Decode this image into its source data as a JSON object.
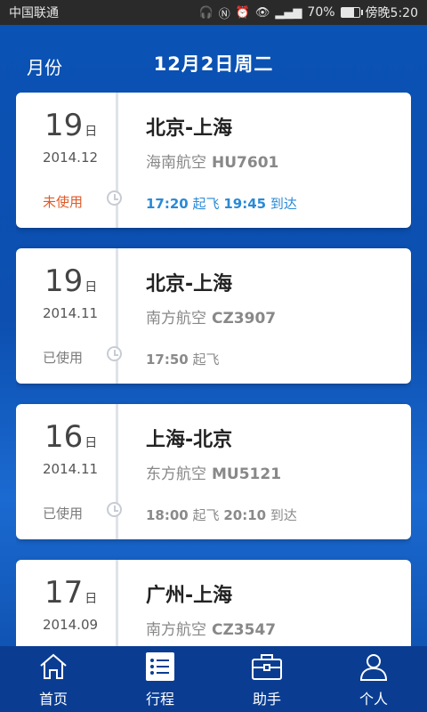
{
  "status_bar": {
    "carrier": "中国联通",
    "battery_text": "70%",
    "time": "傍晚5:20",
    "battery_level": 0.7,
    "icons": [
      "headset-icon",
      "nfc-icon",
      "alarm-icon",
      "eye-icon",
      "signal-icon",
      "battery-icon"
    ]
  },
  "header": {
    "month_label": "月份",
    "date_title": "12月2日周二"
  },
  "trips": [
    {
      "day": "19",
      "day_unit": "日",
      "year_month": "2014.12",
      "status": "未使用",
      "route": "北京-上海",
      "airline": "海南航空",
      "flight": "HU7601",
      "dep_time": "17:20",
      "dep_label": "起飞",
      "arr_time": "19:45",
      "arr_label": "到达"
    },
    {
      "day": "19",
      "day_unit": "日",
      "year_month": "2014.11",
      "status": "已使用",
      "route": "北京-上海",
      "airline": "南方航空",
      "flight": "CZ3907",
      "dep_time": "17:50",
      "dep_label": "起飞",
      "arr_time": "",
      "arr_label": ""
    },
    {
      "day": "16",
      "day_unit": "日",
      "year_month": "2014.11",
      "status": "已使用",
      "route": "上海-北京",
      "airline": "东方航空",
      "flight": "MU5121",
      "dep_time": "18:00",
      "dep_label": "起飞",
      "arr_time": "20:10",
      "arr_label": "到达"
    },
    {
      "day": "17",
      "day_unit": "日",
      "year_month": "2014.09",
      "status": "",
      "route": "广州-上海",
      "airline": "南方航空",
      "flight": "CZ3547",
      "dep_time": "",
      "dep_label": "",
      "arr_time": "",
      "arr_label": ""
    }
  ],
  "tabs": [
    {
      "label": "首页",
      "icon": "home-icon"
    },
    {
      "label": "行程",
      "icon": "itinerary-list-icon"
    },
    {
      "label": "助手",
      "icon": "briefcase-icon"
    },
    {
      "label": "个人",
      "icon": "person-icon"
    }
  ],
  "colors": {
    "accent": "#2a8ad6",
    "unused": "#e05a28",
    "header_bg": "#0a52b4"
  }
}
